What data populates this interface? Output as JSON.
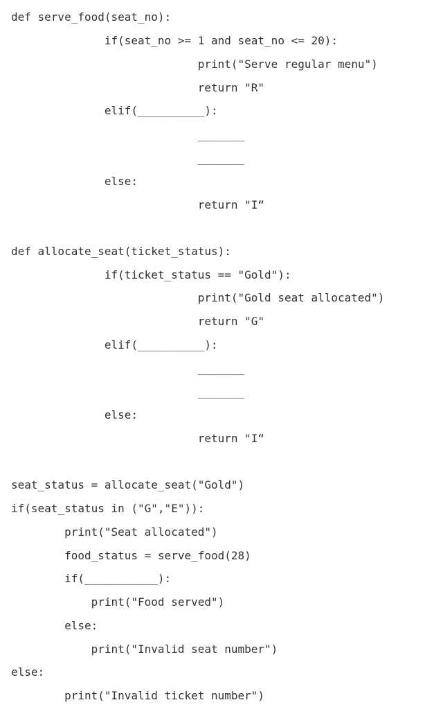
{
  "code": {
    "lines": [
      "def serve_food(seat_no):",
      "              if(seat_no >= 1 and seat_no <= 20):",
      "                            print(\"Serve regular menu\")",
      "                            return \"R\"",
      "              elif(__________):",
      "                            _______",
      "                            _______",
      "              else:",
      "                            return \"I“",
      "",
      "def allocate_seat(ticket_status):",
      "              if(ticket_status == \"Gold\"):",
      "                            print(\"Gold seat allocated\")",
      "                            return \"G\"",
      "              elif(__________):",
      "                            _______",
      "                            _______",
      "              else:",
      "                            return \"I“",
      "",
      "seat_status = allocate_seat(\"Gold\")",
      "if(seat_status in (\"G\",\"E\")):",
      "        print(\"Seat allocated\")",
      "        food_status = serve_food(28)",
      "        if(___________):",
      "            print(\"Food served\")",
      "        else:",
      "            print(\"Invalid seat number\")",
      "else:",
      "        print(\"Invalid ticket number\")"
    ]
  }
}
